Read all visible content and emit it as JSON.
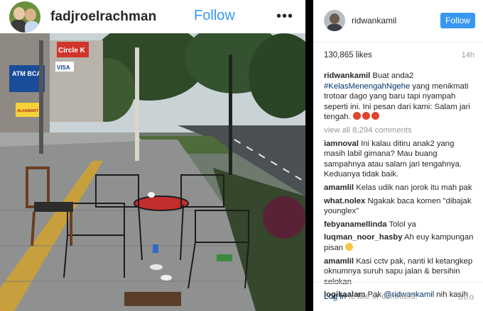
{
  "post": {
    "username": "fadjroelrachman",
    "follow_label": "Follow",
    "more_label": "•••",
    "photo_signs": {
      "circle_k": "Circle K",
      "atm_bca": "ATM BCA",
      "visa": "VISA",
      "store": "ALFAMART"
    }
  },
  "detail": {
    "username": "ridwankamil",
    "follow_label": "Follow",
    "likes": "130,865 likes",
    "age": "14h",
    "caption_user": "ridwankamil",
    "caption_pre": " Buat anda2 ",
    "caption_tag": "#KelasMenengahNgehe",
    "caption_post": " yang menikmati trotoar dago yang baru tapi nyampah seperti ini. Ini pesan dari kami: Salam jari tengah.",
    "view_all": "view all 8,294 comments",
    "comments": [
      {
        "user": "iamnoval",
        "text": " Ini kalau ditiru anak2 yang masih labil gimana? Mau buang sampahnya atau salam jari tengahnya. Keduanya tidak baik."
      },
      {
        "user": "amamlil",
        "text": " Kelas udik nan jorok itu mah pak"
      },
      {
        "user": "what.nolex",
        "text": " Ngakak baca komen \"dibajak younglex\""
      },
      {
        "user": "febyanamellinda",
        "text": " Tolol ya"
      },
      {
        "user": "luqman_noor_hasby",
        "text": " Ah euy kampungan pisan"
      },
      {
        "user": "amamlil",
        "text": " Kasi cctv pak, nanti kl ketangkep oknumnya suruh sapu jalan & bersihin selokan"
      }
    ],
    "last_user": "logikaalam",
    "last_text": " Pak ",
    "last_mention": "@ridwankamil",
    "last_tail": " nih kasih",
    "login_link": "Log in",
    "login_rest": " to like or comment.",
    "more_label": "ooo"
  }
}
